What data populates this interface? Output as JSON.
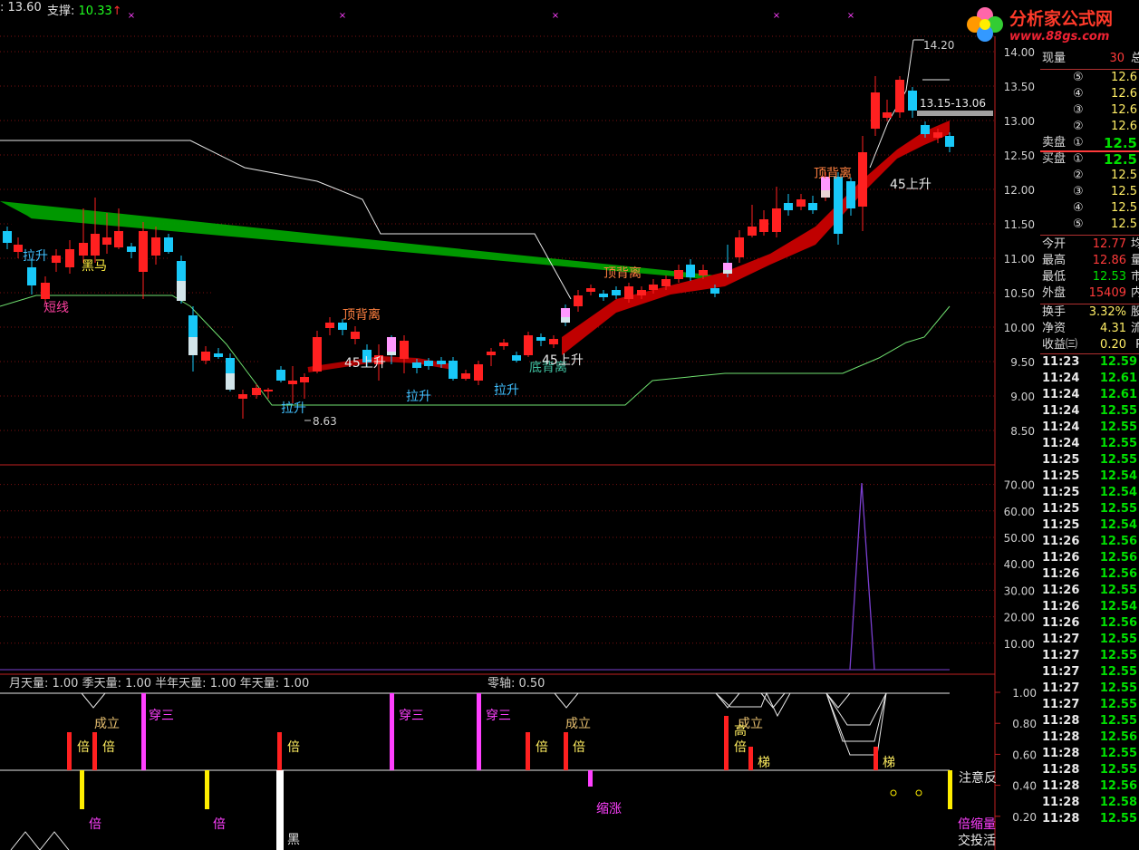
{
  "header": {
    "resist_label": ": 13.60",
    "support_label": "支撑:",
    "support_value": "10.33",
    "support_arrow": "↑"
  },
  "logo": {
    "title": "分析家公式网",
    "url": "www.88gs.com"
  },
  "price_axis": [
    "14.00",
    "13.50",
    "13.00",
    "12.50",
    "12.00",
    "11.50",
    "11.00",
    "10.50",
    "10.00",
    "9.50",
    "9.00",
    "8.50"
  ],
  "mid_axis": [
    "70.00",
    "60.00",
    "50.00",
    "40.00",
    "30.00",
    "20.00",
    "10.00"
  ],
  "bottom_axis": [
    "1.00",
    "0.80",
    "0.60",
    "0.40",
    "0.20"
  ],
  "annotations": {
    "high_price": "14.20",
    "low_price": "8.63",
    "range_box": "13.15-13.06",
    "top_div_1": "顶背离",
    "top_div_2": "顶背离",
    "top_div_3": "顶背离",
    "bottom_div": "底背离",
    "pull_up_1": "拉升",
    "pull_up_2": "拉升",
    "pull_up_3": "拉升",
    "pull_up_4": "拉升",
    "short_line": "短线",
    "dark_horse": "黑马",
    "rise_45_1": "45上升",
    "rise_45_2": "45上升",
    "rise_45_3": "45上升"
  },
  "indicator": {
    "legend_vol": "月天量: 1.00  季天量: 1.00  半年天量: 1.00  年天量: 1.00",
    "zero_axis": "零轴: 0.50",
    "labels": {
      "chengli": "成立",
      "bei": "倍",
      "chuansan": "穿三",
      "ti": "梯",
      "gao": "高",
      "suozhang": "缩涨",
      "hei": "黑",
      "zhuyi": "注意反",
      "beisuo": "倍缩量",
      "jiaotou": "交投活"
    }
  },
  "quote": {
    "volume_label": "现量",
    "volume": "30",
    "volume_tail": "总",
    "sell": [
      {
        "n": "⑤",
        "p": "12.6"
      },
      {
        "n": "④",
        "p": "12.6"
      },
      {
        "n": "③",
        "p": "12.6"
      },
      {
        "n": "②",
        "p": "12.6"
      }
    ],
    "sell1_label": "卖盘",
    "sell1_n": "①",
    "sell1_p": "12.5",
    "buy1_label": "买盘",
    "buy1_n": "①",
    "buy1_p": "12.5",
    "buy": [
      {
        "n": "②",
        "p": "12.5"
      },
      {
        "n": "③",
        "p": "12.5"
      },
      {
        "n": "④",
        "p": "12.5"
      },
      {
        "n": "⑤",
        "p": "12.5"
      }
    ],
    "stats": [
      {
        "label": "今开",
        "value": "12.77",
        "tail": "均",
        "color": "#ff3a3a"
      },
      {
        "label": "最高",
        "value": "12.86",
        "tail": "量",
        "color": "#ff3a3a"
      },
      {
        "label": "最低",
        "value": "12.53",
        "tail": "市",
        "color": "#00e000"
      },
      {
        "label": "外盘",
        "value": "15409",
        "tail": "内",
        "color": "#ff3a3a"
      }
    ],
    "stats2": [
      {
        "label": "换手",
        "value": "3.32%",
        "tail": "股"
      },
      {
        "label": "净资",
        "value": "4.31",
        "tail": "流"
      },
      {
        "label": "收益㈢",
        "value": "0.20",
        "tail": "P"
      }
    ],
    "ticks": [
      {
        "t": "11:23",
        "p": "12.59"
      },
      {
        "t": "11:24",
        "p": "12.61"
      },
      {
        "t": "11:24",
        "p": "12.61"
      },
      {
        "t": "11:24",
        "p": "12.55"
      },
      {
        "t": "11:24",
        "p": "12.55"
      },
      {
        "t": "11:24",
        "p": "12.55"
      },
      {
        "t": "11:25",
        "p": "12.55"
      },
      {
        "t": "11:25",
        "p": "12.54"
      },
      {
        "t": "11:25",
        "p": "12.54"
      },
      {
        "t": "11:25",
        "p": "12.55"
      },
      {
        "t": "11:25",
        "p": "12.54"
      },
      {
        "t": "11:26",
        "p": "12.56"
      },
      {
        "t": "11:26",
        "p": "12.56"
      },
      {
        "t": "11:26",
        "p": "12.56"
      },
      {
        "t": "11:26",
        "p": "12.55"
      },
      {
        "t": "11:26",
        "p": "12.54"
      },
      {
        "t": "11:26",
        "p": "12.56"
      },
      {
        "t": "11:27",
        "p": "12.55"
      },
      {
        "t": "11:27",
        "p": "12.55"
      },
      {
        "t": "11:27",
        "p": "12.55"
      },
      {
        "t": "11:27",
        "p": "12.55"
      },
      {
        "t": "11:27",
        "p": "12.55"
      },
      {
        "t": "11:28",
        "p": "12.55"
      },
      {
        "t": "11:28",
        "p": "12.56"
      },
      {
        "t": "11:28",
        "p": "12.55"
      },
      {
        "t": "11:28",
        "p": "12.55"
      },
      {
        "t": "11:28",
        "p": "12.56"
      },
      {
        "t": "11:28",
        "p": "12.58"
      },
      {
        "t": "11:28",
        "p": "12.55"
      }
    ]
  },
  "colors": {
    "up": "#ff2020",
    "down": "#18c8f8",
    "grid": "#7a1010",
    "axis": "#c02020",
    "text": "#d0d0d0",
    "green": "#00a000"
  }
}
